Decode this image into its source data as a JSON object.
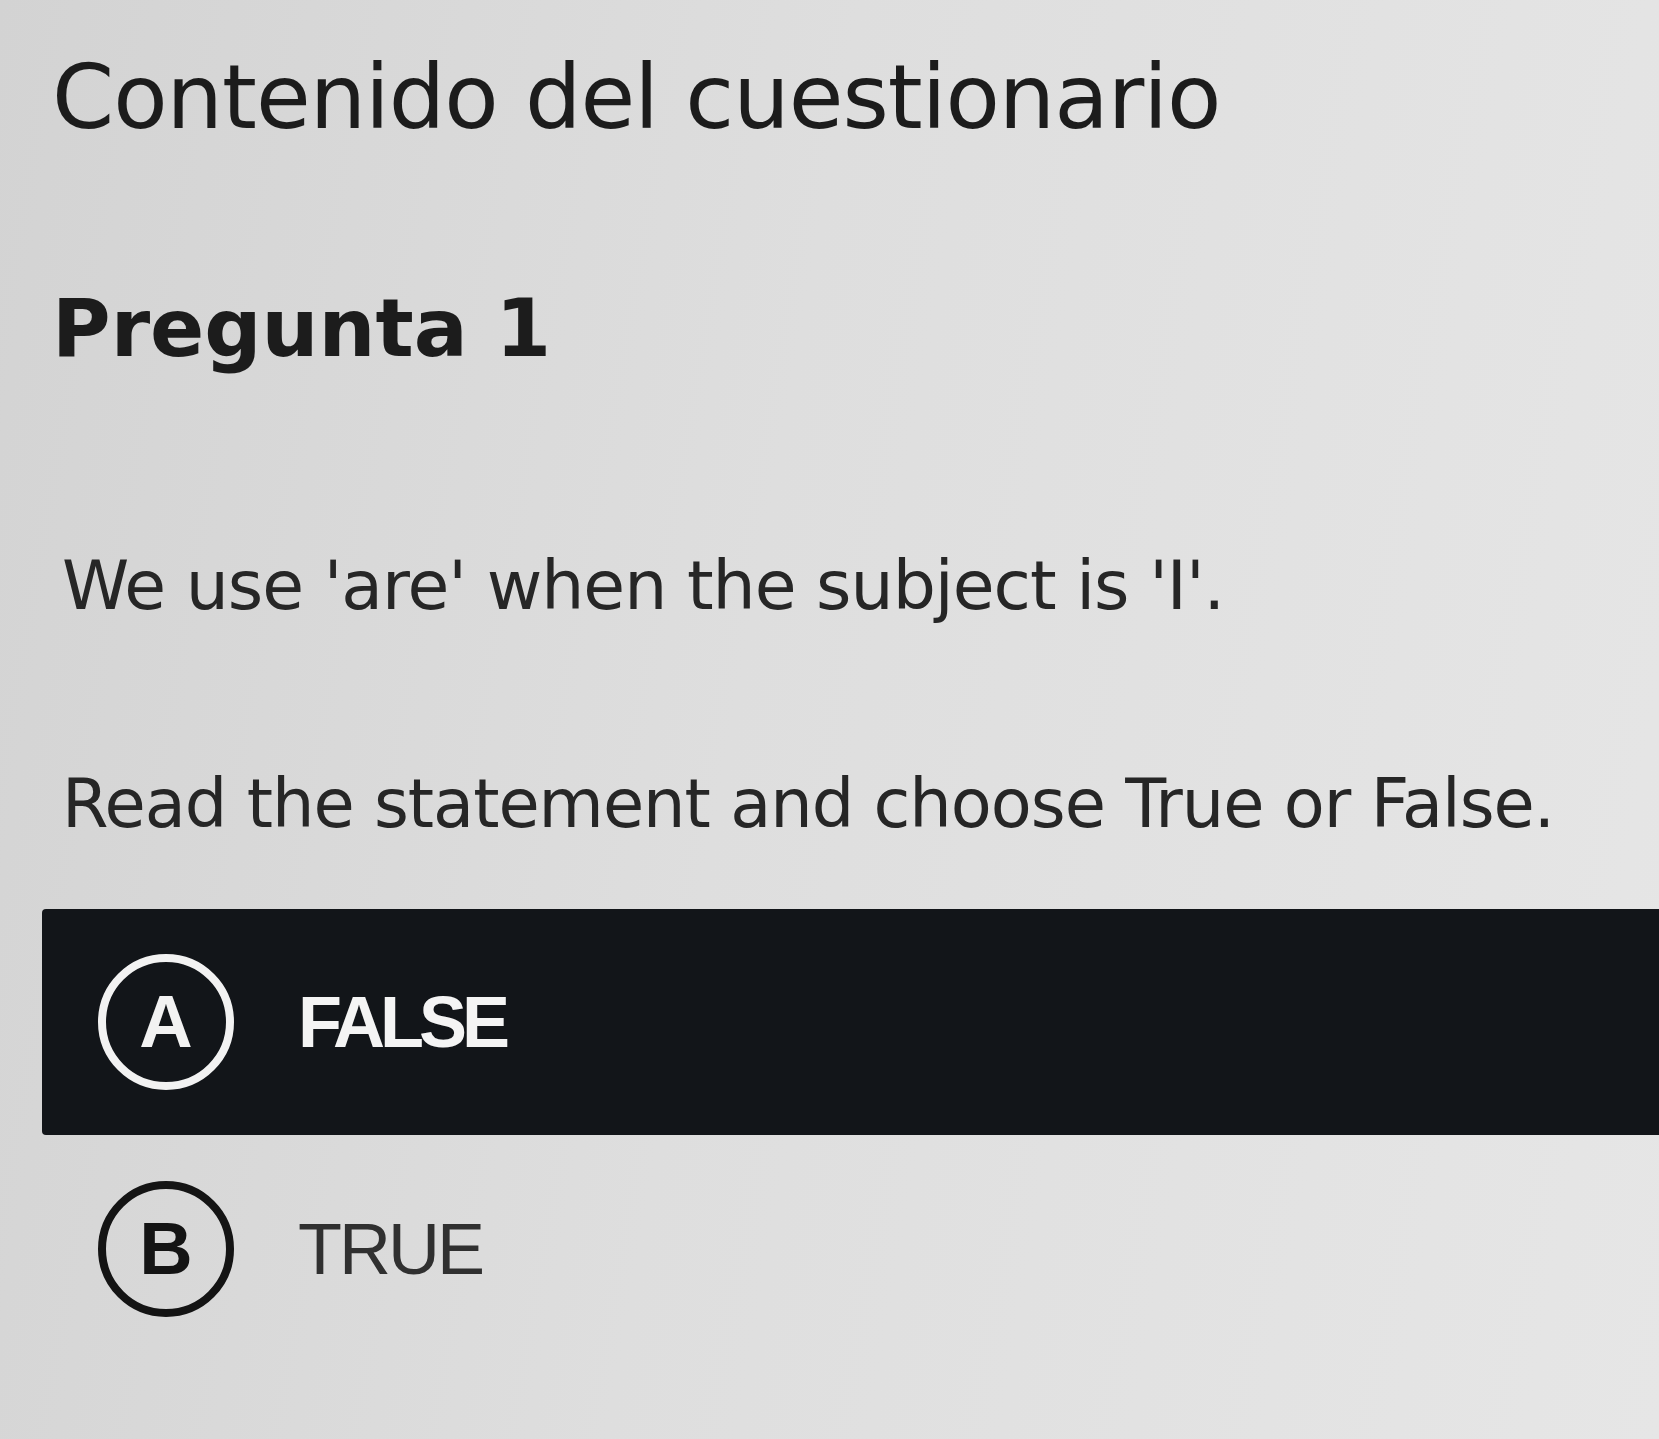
{
  "page": {
    "title": "Contenido del cuestionario"
  },
  "question": {
    "heading": "Pregunta 1",
    "statement": "We use 'are' when the subject is 'I'.",
    "instruction": "Read the statement and choose True or False."
  },
  "options": [
    {
      "letter": "A",
      "label": "FALSE",
      "selected": true
    },
    {
      "letter": "B",
      "label": "TRUE",
      "selected": false
    }
  ]
}
